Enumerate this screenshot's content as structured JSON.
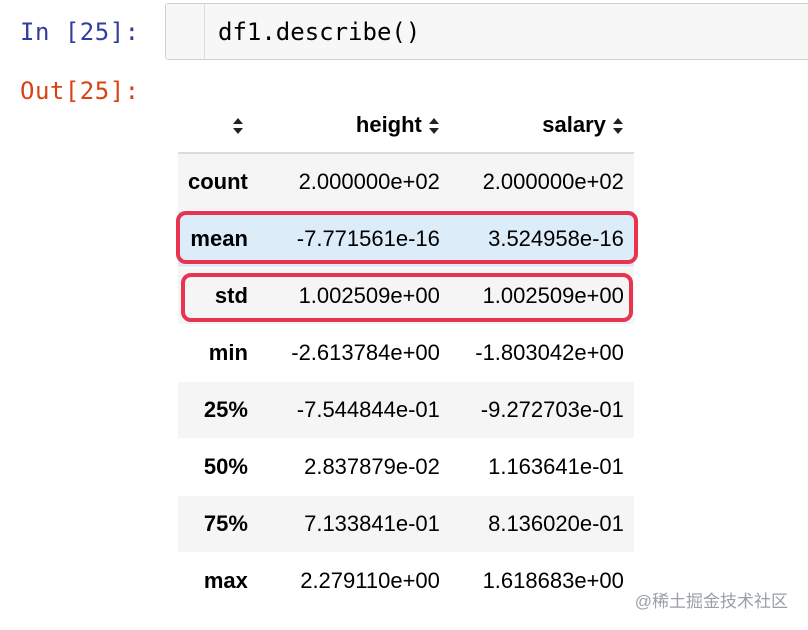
{
  "notebook": {
    "in_prompt": "In [25]:",
    "code": "df1.describe()",
    "out_prompt": "Out[25]:"
  },
  "table": {
    "columns": [
      "height",
      "salary"
    ],
    "rows": [
      {
        "label": "count",
        "height": "2.000000e+02",
        "salary": "2.000000e+02"
      },
      {
        "label": "mean",
        "height": "-7.771561e-16",
        "salary": "3.524958e-16"
      },
      {
        "label": "std",
        "height": "1.002509e+00",
        "salary": "1.002509e+00"
      },
      {
        "label": "min",
        "height": "-2.613784e+00",
        "salary": "-1.803042e+00"
      },
      {
        "label": "25%",
        "height": "-7.544844e-01",
        "salary": "-9.272703e-01"
      },
      {
        "label": "50%",
        "height": "2.837879e-02",
        "salary": "1.163641e-01"
      },
      {
        "label": "75%",
        "height": "7.133841e-01",
        "salary": "8.136020e-01"
      },
      {
        "label": "max",
        "height": "2.279110e+00",
        "salary": "1.618683e+00"
      }
    ],
    "sort_icon": "sort-updown-icon"
  },
  "annotations": {
    "highlight_color": "#e8344f",
    "highlighted_rows": [
      "mean",
      "std"
    ]
  },
  "colors": {
    "in_prompt": "#303f9f",
    "out_prompt": "#d84315",
    "hover_row": "#dcecf9",
    "stripe": "#f5f5f5"
  },
  "watermark": "@稀土掘金技术社区"
}
